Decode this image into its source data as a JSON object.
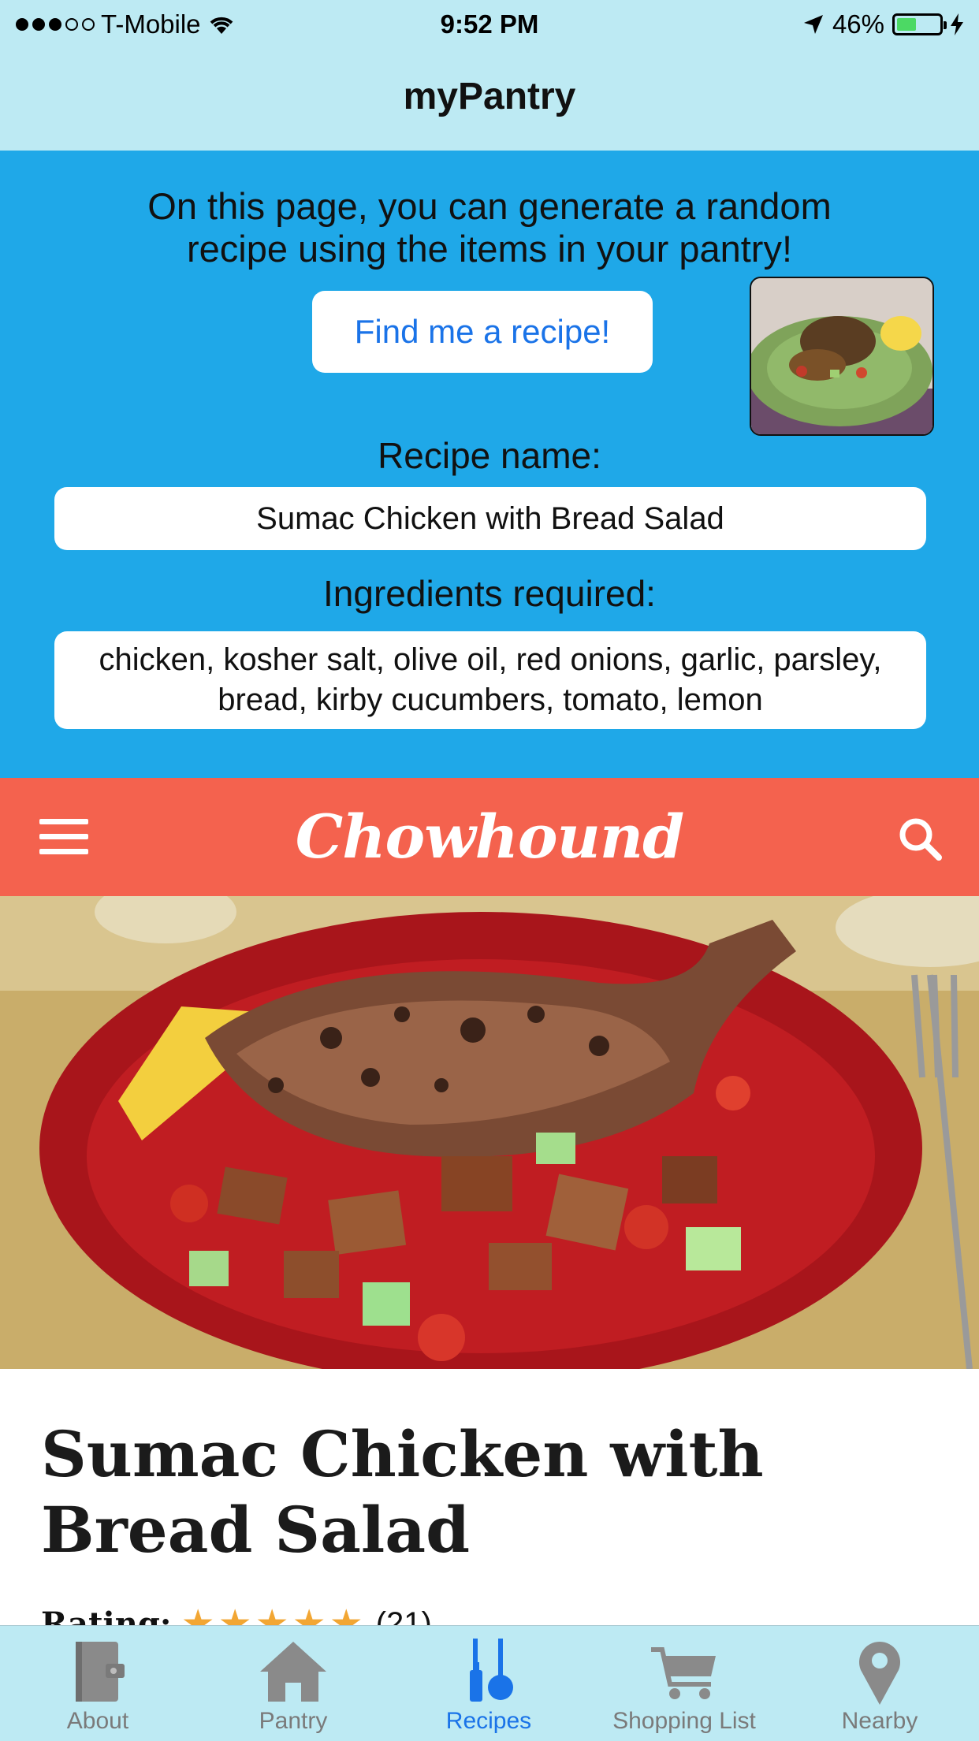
{
  "status_bar": {
    "carrier": "T-Mobile",
    "time": "9:52 PM",
    "battery": "46%",
    "battery_level": 0.46
  },
  "nav": {
    "title": "myPantry"
  },
  "panel": {
    "intro_text": "On this page, you can generate a random recipe using the items in your pantry!",
    "find_button": "Find me a recipe!",
    "recipe_name_label": "Recipe name:",
    "recipe_name_value": "Sumac Chicken with Bread Salad",
    "ingredients_label": "Ingredients required:",
    "ingredients_value": "chicken, kosher salt, olive oil, red onions, garlic, parsley, bread, kirby cucumbers, tomato, lemon"
  },
  "webview": {
    "site_logo": "Chowhound",
    "article_title": "Sumac Chicken with Bread Salad",
    "rating_label": "Rating:",
    "rating_stars": 5,
    "rating_count": "(21)",
    "brand_color": "#f4624e"
  },
  "tabs": [
    {
      "label": "About",
      "icon": "book-icon",
      "active": false
    },
    {
      "label": "Pantry",
      "icon": "home-icon",
      "active": false
    },
    {
      "label": "Recipes",
      "icon": "utensils-icon",
      "active": true
    },
    {
      "label": "Shopping List",
      "icon": "cart-icon",
      "active": false
    },
    {
      "label": "Nearby",
      "icon": "location-pin-icon",
      "active": false
    }
  ],
  "colors": {
    "nav_bg": "#bdeaf3",
    "panel_bg": "#1fa8e8",
    "active_tab": "#1a73e8"
  }
}
